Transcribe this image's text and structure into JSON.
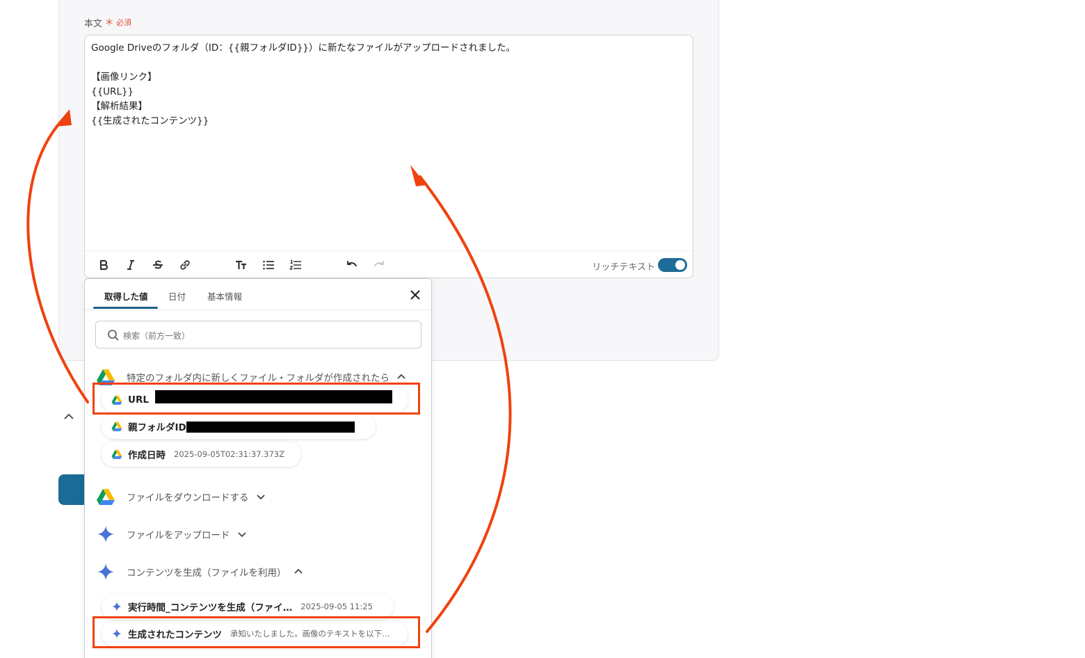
{
  "form": {
    "label": "本文",
    "required_mark": "＊",
    "required_text": "必須",
    "body_lines": [
      "Google Driveのフォルダ（ID：{{親フォルダID}}）に新たなファイルがアップロードされました。",
      "",
      "【画像リンク】",
      "{{URL}}",
      "【解析結果】",
      "{{生成されたコンテンツ}}"
    ],
    "toolbar": {
      "items": [
        "bold-icon",
        "italic-icon",
        "strikethrough-icon",
        "link-icon",
        "text-size-icon",
        "bullet-list-icon",
        "numbered-list-icon",
        "undo-icon",
        "redo-icon"
      ],
      "rich_text_label": "リッチテキスト",
      "rich_text_enabled": true
    }
  },
  "popup": {
    "tabs": [
      "取得した値",
      "日付",
      "基本情報"
    ],
    "active_tab": "取得した値",
    "search_placeholder": "検索（前方一致）",
    "sections": [
      {
        "title": "特定のフォルダ内に新しくファイル・フォルダが作成されたら",
        "icon": "google-drive-icon",
        "expanded": true,
        "items": [
          {
            "name": "URL",
            "value": ""
          },
          {
            "name": "親フォルダID",
            "value": ""
          },
          {
            "name": "作成日時",
            "value": "2025-09-05T02:31:37.373Z"
          }
        ]
      },
      {
        "title": "ファイルをダウンロードする",
        "icon": "google-drive-icon",
        "expanded": false
      },
      {
        "title": "ファイルをアップロード",
        "icon": "gemini-sparkle-icon",
        "expanded": false
      },
      {
        "title": "コンテンツを生成（ファイルを利用）",
        "icon": "gemini-sparkle-icon",
        "expanded": true,
        "items": [
          {
            "name": "実行時間_コンテンツを生成（ファイ…",
            "value": "2025-09-05 11:25"
          },
          {
            "name": "生成されたコンテンツ",
            "value": "承知いたしました。画像のテキストを以下…"
          }
        ]
      }
    ]
  },
  "colors": {
    "highlight": "#f0420f",
    "accent": "#1f6c9a",
    "required": "#e0533d"
  }
}
